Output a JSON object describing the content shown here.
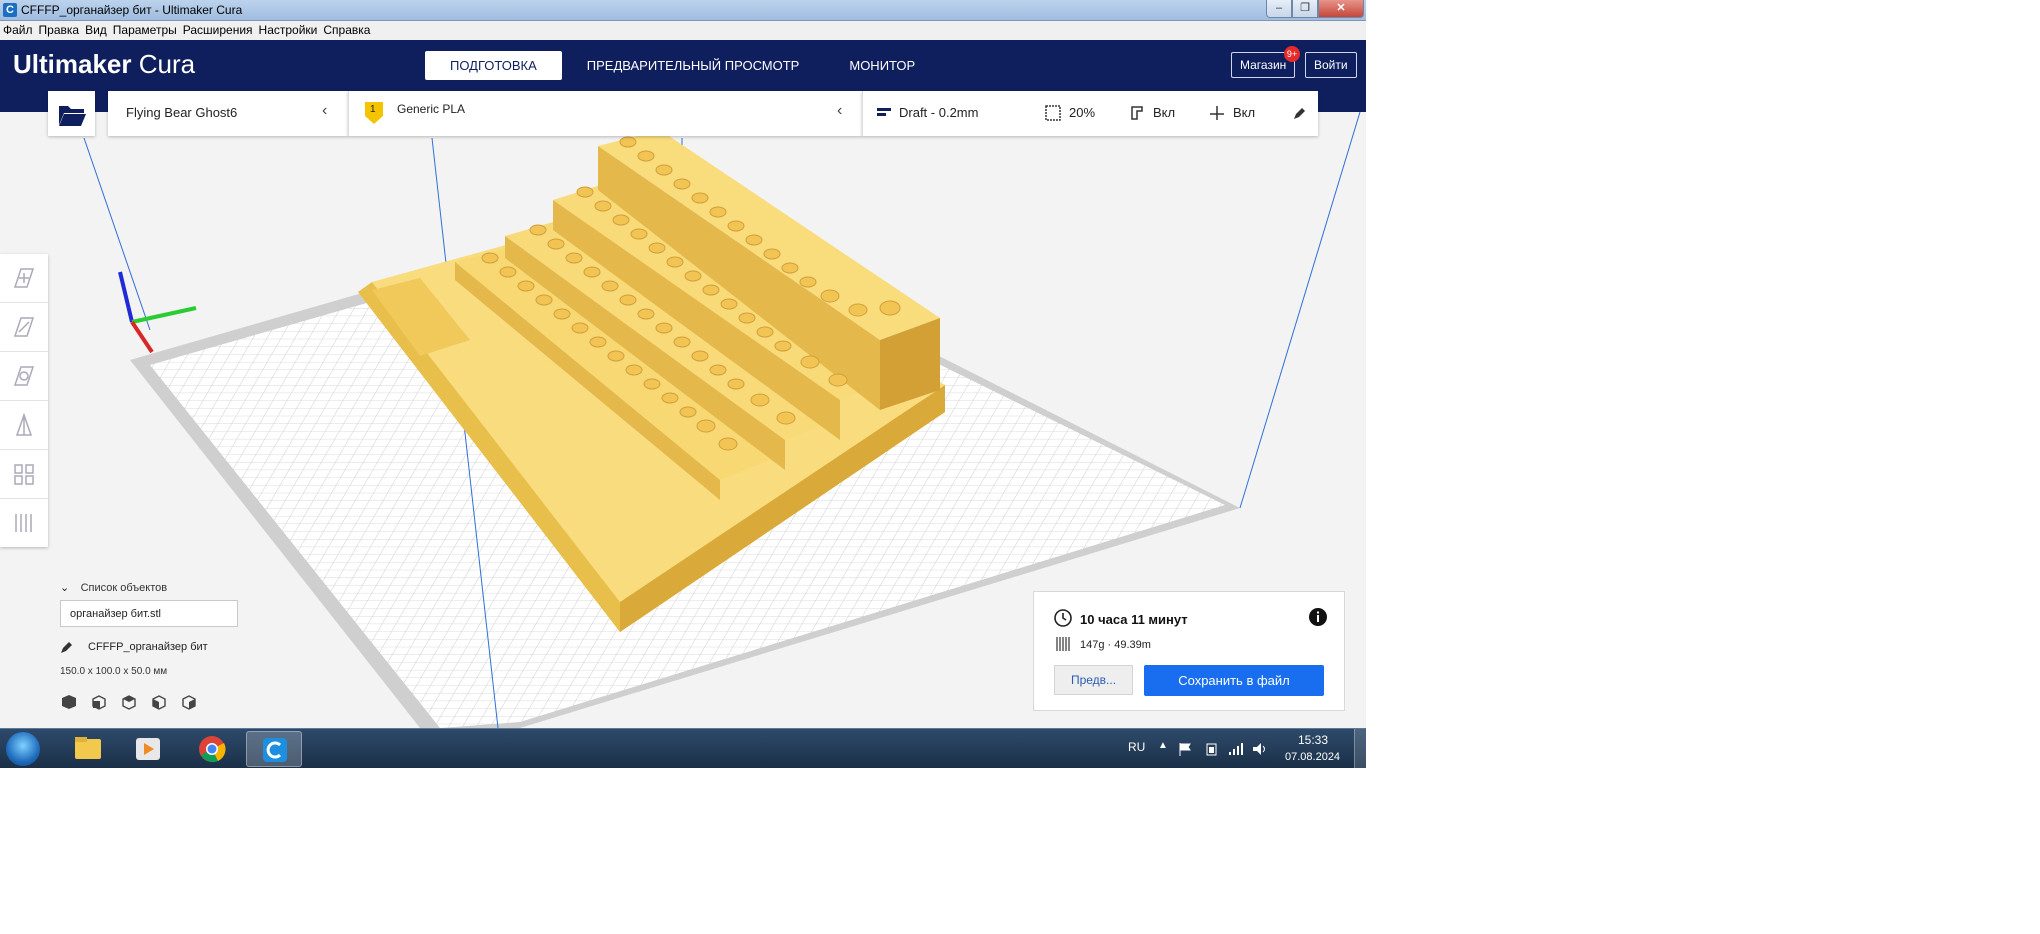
{
  "window": {
    "title": "CFFFP_органайзер бит - Ultimaker Cura",
    "app_icon": "С"
  },
  "menu": [
    "Файл",
    "Правка",
    "Вид",
    "Параметры",
    "Расширения",
    "Настройки",
    "Справка"
  ],
  "header": {
    "logo_bold": "Ultimaker",
    "logo_light": " Cura",
    "stages": [
      "ПОДГОТОВКА",
      "ПРЕДВАРИТЕЛЬНЫЙ ПРОСМОТР",
      "МОНИТОР"
    ],
    "active_stage": "ПОДГОТОВКА",
    "marketplace": "Магазин",
    "marketplace_badge": "9+",
    "signin": "Войти"
  },
  "config": {
    "printer": "Flying Bear Ghost6",
    "extruder_number": "1",
    "material": "Generic PLA",
    "profile": "Draft - 0.2mm",
    "infill": "20%",
    "support": "Вкл",
    "adhesion": "Вкл"
  },
  "object_list": {
    "header": "Список объектов",
    "file": "органайзер бит.stl",
    "job_name": "CFFFP_органайзер бит",
    "dimensions": "150.0 x 100.0 x 50.0 мм"
  },
  "print_info": {
    "time": "10 часа 11 минут",
    "material_usage": "147g · 49.39m",
    "preview_button": "Предв...",
    "save_button": "Сохранить в файл"
  },
  "taskbar": {
    "language": "RU",
    "time": "15:33",
    "date": "07.08.2024"
  },
  "colors": {
    "header_bg": "#0f1f5e",
    "accent_blue": "#196ef0",
    "model_yellow": "#f5d26b",
    "badge_red": "#e52b2b"
  }
}
